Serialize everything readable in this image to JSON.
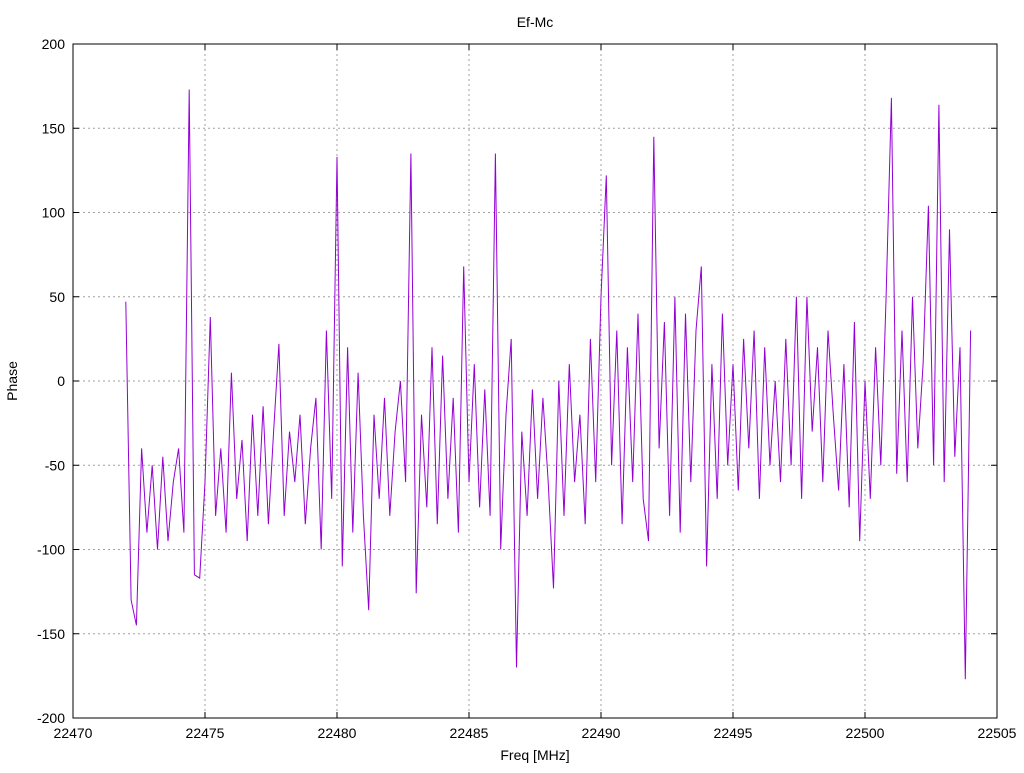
{
  "chart_data": {
    "type": "line",
    "title": "Ef-Mc",
    "xlabel": "Freq [MHz]",
    "ylabel": "Phase",
    "xlim": [
      22470,
      22505
    ],
    "ylim": [
      -200,
      200
    ],
    "xticks": [
      22470,
      22475,
      22480,
      22485,
      22490,
      22495,
      22500,
      22505
    ],
    "yticks": [
      -200,
      -150,
      -100,
      -50,
      0,
      50,
      100,
      150,
      200
    ],
    "grid": true,
    "line_color": "#9400d3",
    "series": [
      {
        "name": "Ef-Mc",
        "x_start": 22472.0,
        "x_step": 0.2,
        "values": [
          47,
          -130,
          -145,
          -40,
          -90,
          -50,
          -100,
          -45,
          -95,
          -60,
          -40,
          -90,
          173,
          -115,
          -117,
          -60,
          38,
          -80,
          -40,
          -90,
          5,
          -70,
          -35,
          -95,
          -20,
          -80,
          -15,
          -85,
          -30,
          22,
          -80,
          -30,
          -60,
          -20,
          -85,
          -40,
          -10,
          -100,
          30,
          -70,
          133,
          -110,
          20,
          -90,
          5,
          -80,
          -136,
          -20,
          -70,
          -10,
          -80,
          -30,
          0,
          -60,
          135,
          -126,
          -20,
          -75,
          20,
          -85,
          15,
          -70,
          -10,
          -90,
          68,
          -60,
          10,
          -75,
          -5,
          -80,
          135,
          -100,
          -20,
          25,
          -170,
          -30,
          -80,
          -5,
          -70,
          -10,
          -60,
          -123,
          0,
          -80,
          10,
          -60,
          -20,
          -85,
          25,
          -60,
          50,
          122,
          -50,
          30,
          -85,
          20,
          -60,
          40,
          -70,
          -95,
          145,
          -40,
          35,
          -80,
          50,
          -90,
          40,
          -60,
          30,
          68,
          -110,
          10,
          -70,
          40,
          -50,
          10,
          -65,
          25,
          -40,
          30,
          -70,
          20,
          -50,
          0,
          -60,
          25,
          -50,
          50,
          -70,
          50,
          -30,
          20,
          -60,
          30,
          -20,
          -65,
          10,
          -75,
          35,
          -95,
          0,
          -70,
          20,
          -50,
          50,
          168,
          -55,
          30,
          -60,
          50,
          -40,
          10,
          104,
          -50,
          164,
          -60,
          90,
          -45,
          20,
          -177,
          30
        ]
      }
    ]
  }
}
